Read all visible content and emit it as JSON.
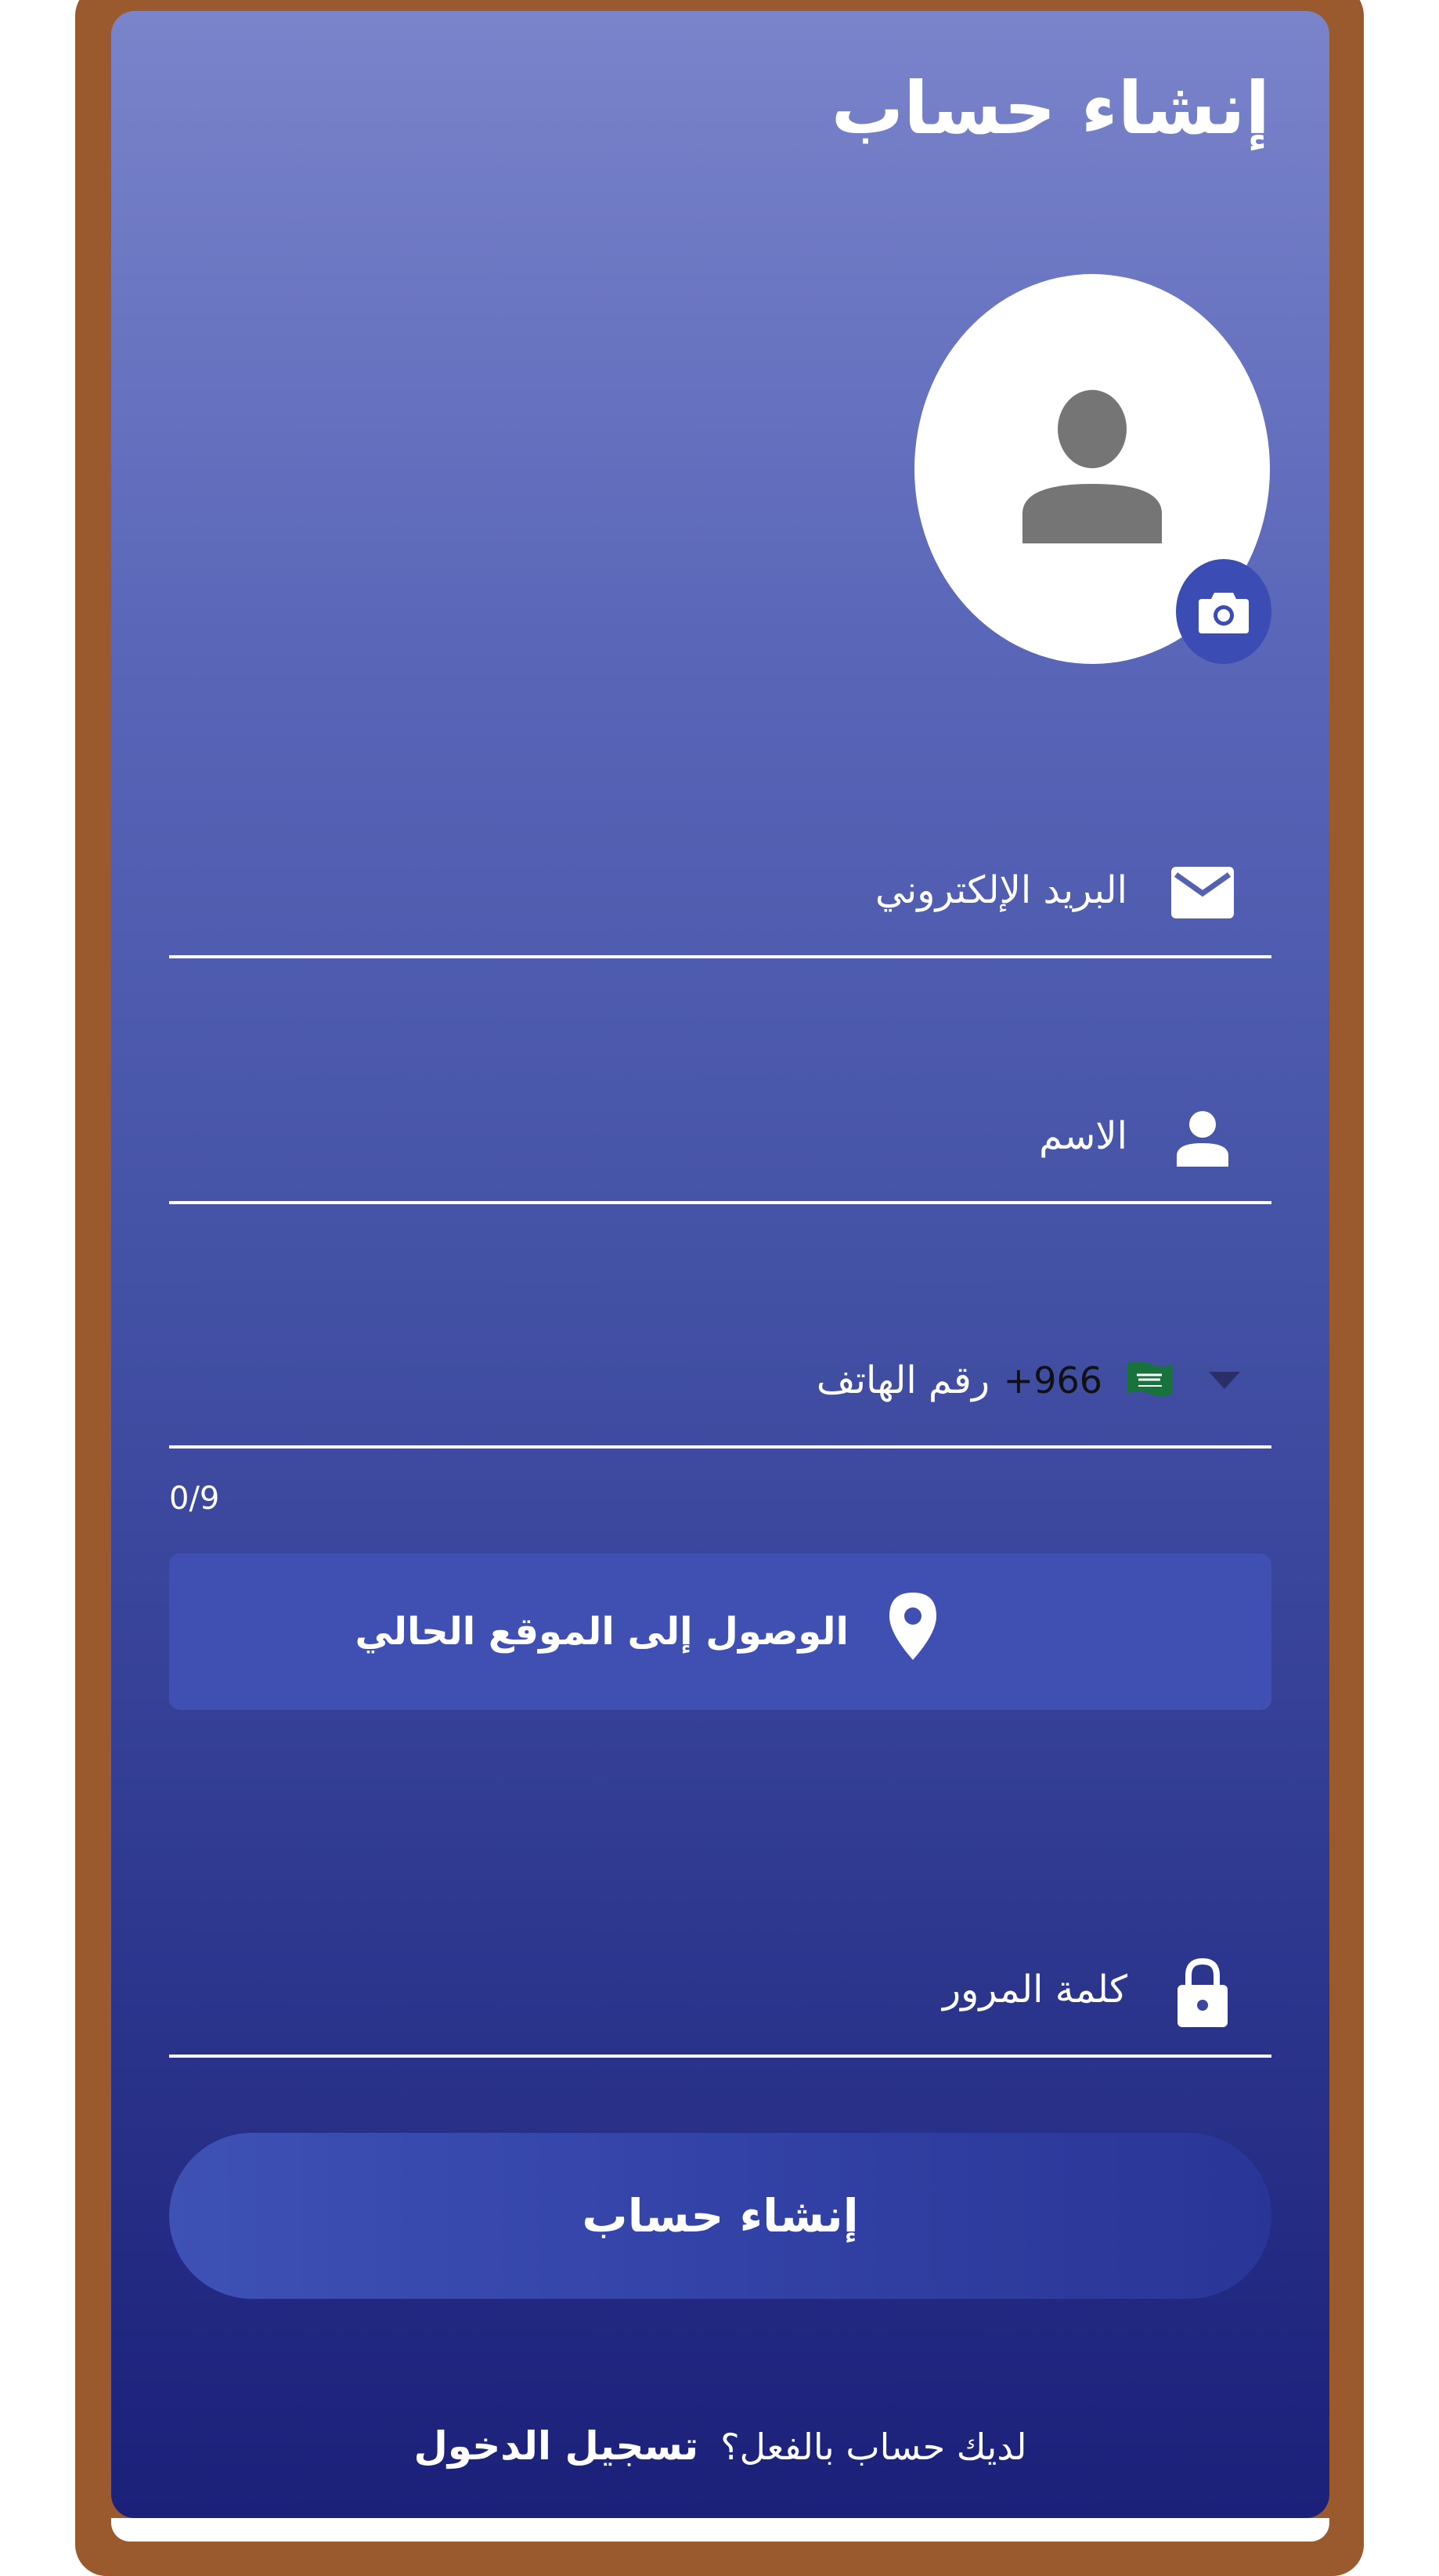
{
  "header": {
    "title": "إنشاء حساب"
  },
  "form": {
    "email_label": "البريد الإلكتروني",
    "name_label": "الاسم",
    "phone_label": "رقم الهاتف",
    "country_code": "+966",
    "phone_counter": "0/9",
    "location_button_label": "الوصول إلى الموقع الحالي",
    "password_label": "كلمة المرور",
    "submit_label": "إنشاء حساب"
  },
  "footer": {
    "prompt": "لديك حساب بالفعل؟",
    "login_link": "تسجيل الدخول"
  },
  "icons": {
    "email": "envelope-icon",
    "name": "person-icon",
    "phone_country": "saudi-flag-icon",
    "location": "map-pin-icon",
    "password": "lock-icon",
    "avatar": "user-placeholder-icon",
    "camera": "camera-icon"
  },
  "colors": {
    "frame": "#9a5a2e",
    "gradient_top": "#7a84cb",
    "gradient_bottom": "#1b2079",
    "accent": "#3f50b2"
  }
}
